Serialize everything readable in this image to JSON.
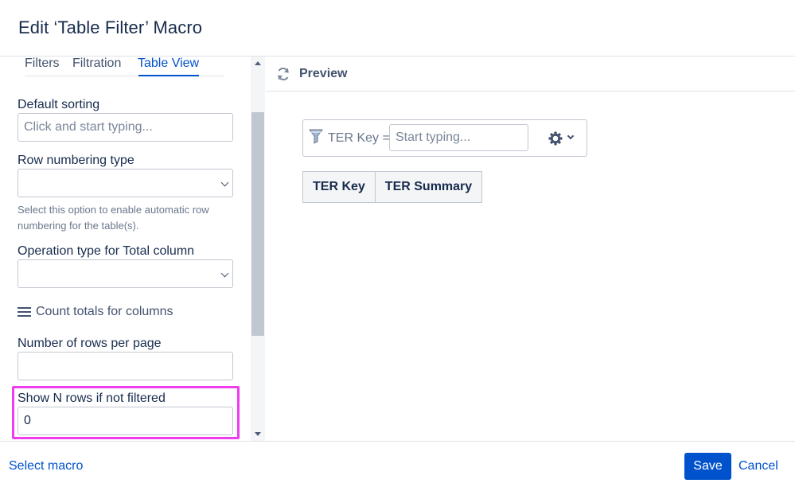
{
  "dialog": {
    "title": "Edit ‘Table Filter’ Macro"
  },
  "tabs": [
    {
      "label": "Filters"
    },
    {
      "label": "Filtration"
    },
    {
      "label": "Table View",
      "active": true
    }
  ],
  "form": {
    "default_sorting": {
      "label": "Default sorting",
      "placeholder": "Click and start typing...",
      "value": ""
    },
    "row_numbering": {
      "label": "Row numbering type",
      "value": "",
      "help": "Select this option to enable automatic row numbering for the table(s)."
    },
    "operation_type": {
      "label": "Operation type for Total column",
      "value": ""
    },
    "count_totals": {
      "label": "Count totals for columns",
      "icon": "hamburger-icon"
    },
    "rows_per_page": {
      "label": "Number of rows per page",
      "value": ""
    },
    "show_n_rows": {
      "label": "Show N rows if not filtered",
      "value": "0"
    }
  },
  "preview": {
    "label": "Preview",
    "filter": {
      "label": "TER Key =",
      "placeholder": "Start typing..."
    },
    "table": {
      "headers": [
        "TER Key",
        "TER Summary"
      ]
    }
  },
  "footer": {
    "select_macro": "Select macro",
    "save": "Save",
    "cancel": "Cancel"
  },
  "colors": {
    "accent": "#0052cc",
    "highlight": "#ee3cee",
    "text": "#172b4d",
    "border": "#c1c7d0"
  }
}
